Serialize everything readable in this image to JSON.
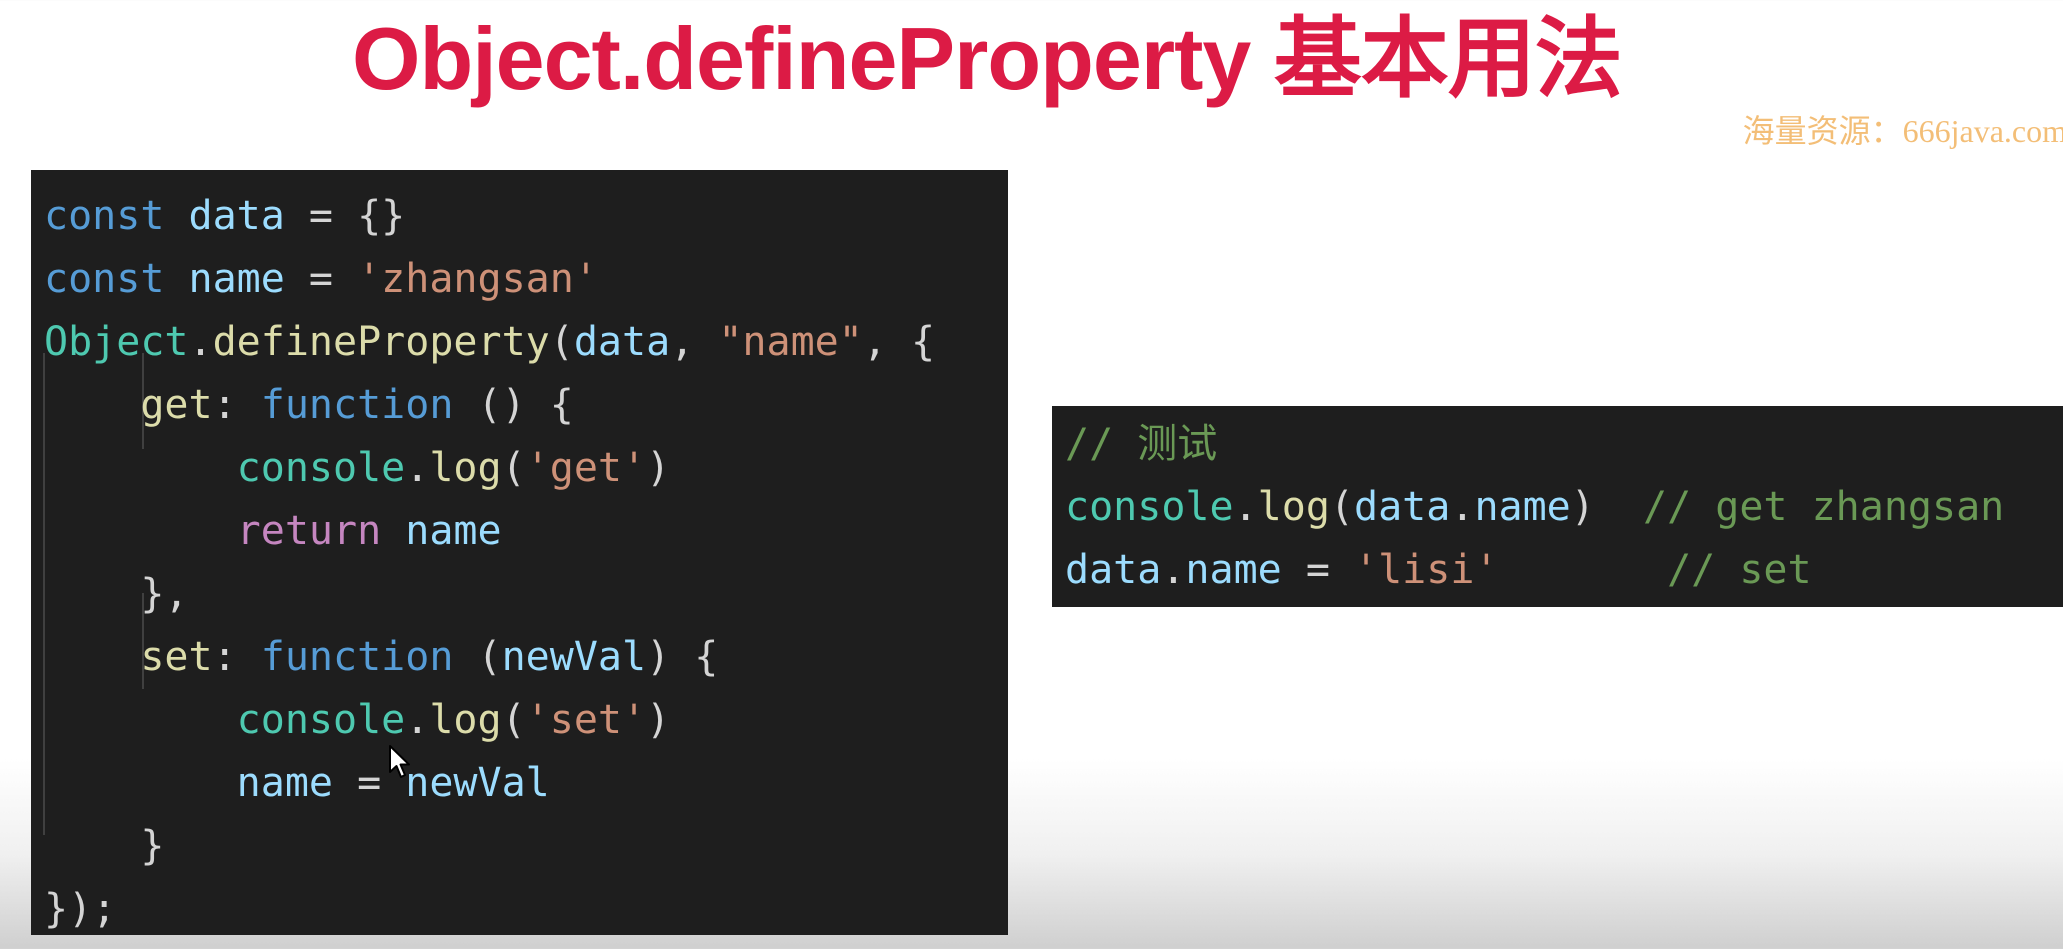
{
  "slide": {
    "title": "Object.defineProperty 基本用法",
    "watermark": "海量资源：666java.com"
  },
  "main_code": {
    "lines": [
      [
        [
          "kw",
          "const"
        ],
        [
          "pun",
          " "
        ],
        [
          "var",
          "data"
        ],
        [
          "pun",
          " = {}"
        ]
      ],
      [
        [
          "kw",
          "const"
        ],
        [
          "pun",
          " "
        ],
        [
          "var",
          "name"
        ],
        [
          "pun",
          " = "
        ],
        [
          "str",
          "'zhangsan'"
        ]
      ],
      [
        [
          "cls",
          "Object"
        ],
        [
          "pun",
          "."
        ],
        [
          "fn",
          "defineProperty"
        ],
        [
          "pun",
          "("
        ],
        [
          "var",
          "data"
        ],
        [
          "pun",
          ", "
        ],
        [
          "str",
          "\"name\""
        ],
        [
          "pun",
          ", {"
        ]
      ],
      [
        [
          "pun",
          "    "
        ],
        [
          "fn",
          "get"
        ],
        [
          "pun",
          ": "
        ],
        [
          "kw",
          "function"
        ],
        [
          "pun",
          " () {"
        ]
      ],
      [
        [
          "pun",
          "        "
        ],
        [
          "cls",
          "console"
        ],
        [
          "pun",
          "."
        ],
        [
          "fn",
          "log"
        ],
        [
          "pun",
          "("
        ],
        [
          "str",
          "'get'"
        ],
        [
          "pun",
          ")"
        ]
      ],
      [
        [
          "pun",
          "        "
        ],
        [
          "ctl",
          "return"
        ],
        [
          "pun",
          " "
        ],
        [
          "var",
          "name"
        ]
      ],
      [
        [
          "pun",
          "    },"
        ]
      ],
      [
        [
          "pun",
          "    "
        ],
        [
          "fn",
          "set"
        ],
        [
          "pun",
          ": "
        ],
        [
          "kw",
          "function"
        ],
        [
          "pun",
          " ("
        ],
        [
          "var",
          "newVal"
        ],
        [
          "pun",
          ") {"
        ]
      ],
      [
        [
          "pun",
          "        "
        ],
        [
          "cls",
          "console"
        ],
        [
          "pun",
          "."
        ],
        [
          "fn",
          "log"
        ],
        [
          "pun",
          "("
        ],
        [
          "str",
          "'set'"
        ],
        [
          "pun",
          ")"
        ]
      ],
      [
        [
          "pun",
          "        "
        ],
        [
          "var",
          "name"
        ],
        [
          "pun",
          " = "
        ],
        [
          "var",
          "newVal"
        ]
      ],
      [
        [
          "pun",
          "    }"
        ]
      ],
      [
        [
          "pun",
          "});"
        ]
      ]
    ]
  },
  "test_code": {
    "lines": [
      [
        [
          "cmt",
          "// 测试"
        ]
      ],
      [
        [
          "cls",
          "console"
        ],
        [
          "pun",
          "."
        ],
        [
          "fn",
          "log"
        ],
        [
          "pun",
          "("
        ],
        [
          "var",
          "data"
        ],
        [
          "pun",
          "."
        ],
        [
          "var",
          "name"
        ],
        [
          "pun",
          ")  "
        ],
        [
          "cmt",
          "// get zhangsan"
        ]
      ],
      [
        [
          "var",
          "data"
        ],
        [
          "pun",
          "."
        ],
        [
          "var",
          "name"
        ],
        [
          "pun",
          " = "
        ],
        [
          "str",
          "'lisi'"
        ],
        [
          "pun",
          "       "
        ],
        [
          "cmt",
          "// set"
        ]
      ]
    ]
  },
  "icons": {
    "cursor": "mouse-pointer-icon"
  }
}
